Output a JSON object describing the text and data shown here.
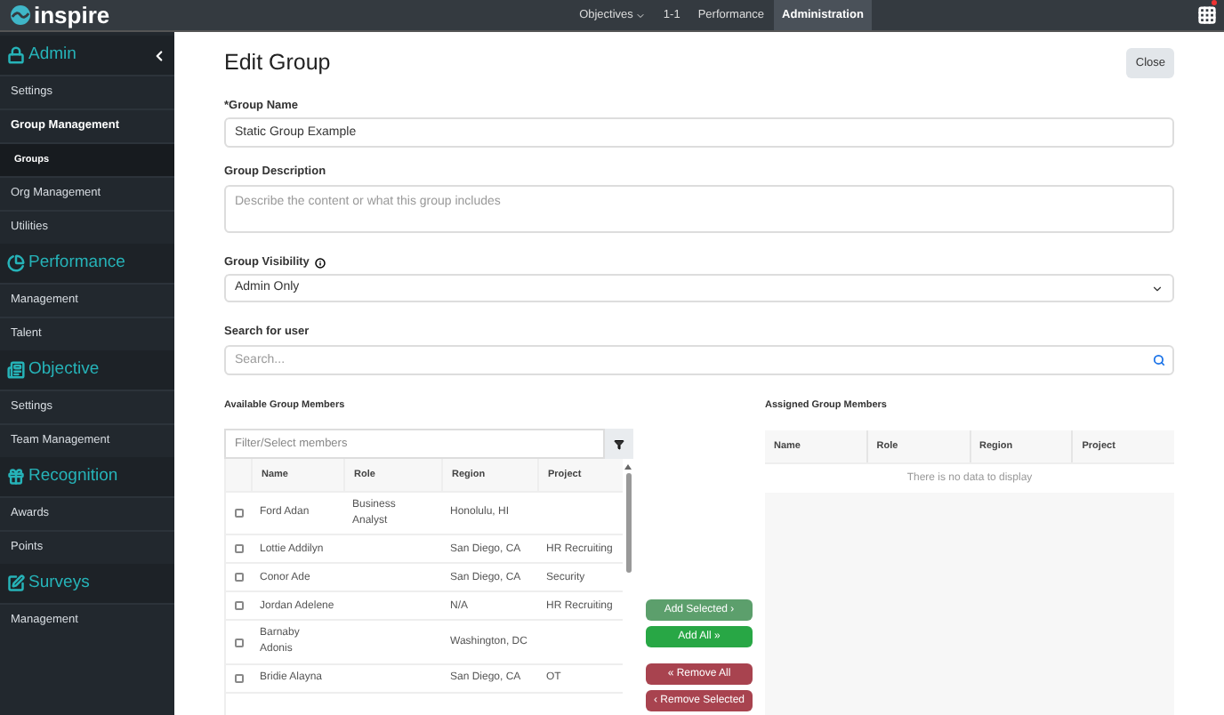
{
  "brand": {
    "name": "inspire"
  },
  "nav": {
    "items": [
      {
        "label": "Objectives",
        "dropdown": true,
        "selected": false
      },
      {
        "label": "1-1",
        "dropdown": false,
        "selected": false
      },
      {
        "label": "Performance",
        "dropdown": false,
        "selected": false
      },
      {
        "label": "Administration",
        "dropdown": false,
        "selected": true
      }
    ],
    "notification": true
  },
  "sidebar": {
    "sections": [
      {
        "title": "Admin",
        "collapsible": true,
        "items": [
          {
            "label": "Settings",
            "selected": false,
            "kind": "item"
          },
          {
            "label": "Group Management",
            "selected": true,
            "kind": "item"
          },
          {
            "label": "Groups",
            "selected": true,
            "kind": "sub"
          },
          {
            "label": "Org Management",
            "selected": false,
            "kind": "item"
          },
          {
            "label": "Utilities",
            "selected": false,
            "kind": "item"
          }
        ]
      },
      {
        "title": "Performance",
        "collapsible": false,
        "items": [
          {
            "label": "Management",
            "selected": false,
            "kind": "item"
          },
          {
            "label": "Talent",
            "selected": false,
            "kind": "item"
          }
        ]
      },
      {
        "title": "Objective",
        "collapsible": false,
        "items": [
          {
            "label": "Settings",
            "selected": false,
            "kind": "item"
          },
          {
            "label": "Team Management",
            "selected": false,
            "kind": "item"
          }
        ]
      },
      {
        "title": "Recognition",
        "collapsible": false,
        "items": [
          {
            "label": "Awards",
            "selected": false,
            "kind": "item"
          },
          {
            "label": "Points",
            "selected": false,
            "kind": "item"
          }
        ]
      },
      {
        "title": "Surveys",
        "collapsible": false,
        "items": [
          {
            "label": "Management",
            "selected": false,
            "kind": "item"
          }
        ]
      }
    ]
  },
  "page": {
    "title": "Edit Group",
    "close_button": "Close"
  },
  "form": {
    "group_name": {
      "label": "*Group Name",
      "value": "Static Group Example"
    },
    "group_description": {
      "label": "Group Description",
      "placeholder": "Describe the content or what this group includes"
    },
    "group_visibility": {
      "label": "Group Visibility",
      "value": "Admin Only"
    },
    "search_user": {
      "label": "Search for user",
      "placeholder": "Search..."
    }
  },
  "available": {
    "title": "Available Group Members",
    "filter_placeholder": "Filter/Select members",
    "columns": [
      "Name",
      "Role",
      "Region",
      "Project"
    ],
    "rows": [
      {
        "name": "Ford Adan",
        "role": "Business Analyst",
        "region": "Honolulu, HI",
        "project": "",
        "checked": false
      },
      {
        "name": "Lottie Addilyn",
        "role": "",
        "region": "San Diego, CA",
        "project": "HR Recruiting",
        "checked": false
      },
      {
        "name": "Conor Ade",
        "role": "",
        "region": "San Diego, CA",
        "project": "Security",
        "checked": false
      },
      {
        "name": "Jordan Adelene",
        "role": "",
        "region": "N/A",
        "project": "HR Recruiting",
        "checked": false
      },
      {
        "name": "Barnaby Adonis",
        "role": "",
        "region": "Washington, DC",
        "project": "",
        "checked": false
      },
      {
        "name": "Bridie Alayna",
        "role": "",
        "region": "San Diego, CA",
        "project": "OT",
        "checked": false
      }
    ]
  },
  "transfer_buttons": [
    {
      "label": "Add Selected ›",
      "kind": "add",
      "disabled": true
    },
    {
      "label": "Add All »",
      "kind": "add",
      "disabled": false
    },
    {
      "label": "« Remove All",
      "kind": "remove",
      "disabled": false
    },
    {
      "label": "‹ Remove Selected",
      "kind": "remove",
      "disabled": false
    }
  ],
  "assigned": {
    "title": "Assigned Group Members",
    "columns": [
      "Name",
      "Role",
      "Region",
      "Project"
    ],
    "empty_message": "There is no data to display"
  }
}
